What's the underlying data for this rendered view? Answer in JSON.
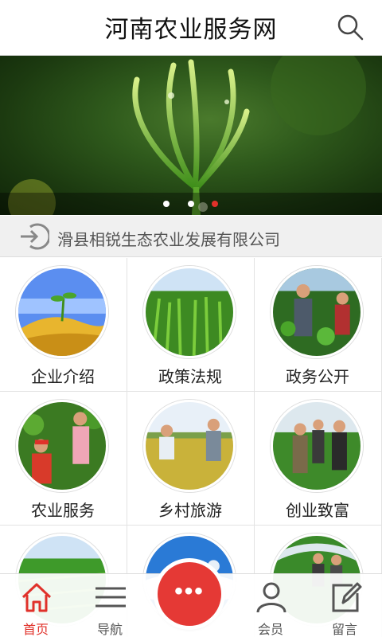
{
  "header": {
    "title": "河南农业服务网",
    "search_icon": "search-icon"
  },
  "banner": {
    "slides": 3,
    "active_slide": 3
  },
  "notice": {
    "icon": "login-arrow-icon",
    "text": "滑县相锐生态农业发展有限公司"
  },
  "grid": {
    "items": [
      {
        "label": "企业介绍"
      },
      {
        "label": "政策法规"
      },
      {
        "label": "政务公开"
      },
      {
        "label": "农业服务"
      },
      {
        "label": "乡村旅游"
      },
      {
        "label": "创业致富"
      },
      {
        "label": ""
      },
      {
        "label": ""
      },
      {
        "label": ""
      }
    ]
  },
  "tabbar": {
    "items": [
      {
        "label": "首页",
        "icon": "home-icon",
        "active": true
      },
      {
        "label": "导航",
        "icon": "menu-icon",
        "active": false
      },
      {
        "label": "会员",
        "icon": "user-icon",
        "active": false
      },
      {
        "label": "留言",
        "icon": "edit-icon",
        "active": false
      }
    ],
    "fab": {
      "label": "•••",
      "icon": "more-icon"
    }
  },
  "colors": {
    "accent": "#e0312a",
    "fab": "#e53935"
  }
}
